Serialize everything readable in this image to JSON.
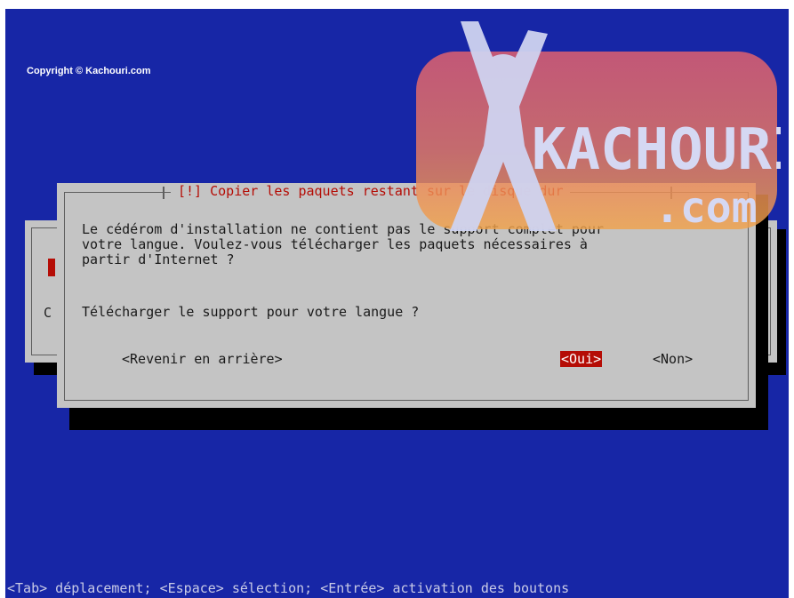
{
  "watermark": {
    "copyright": "Copyright © Kachouri.com",
    "logo_text": "KACHOURI",
    "logo_domain": ".com"
  },
  "background_dialog": {
    "visible_letter": "C"
  },
  "dialog": {
    "title": "[!] Copier les paquets restant sur le disque dur",
    "body_lines": [
      "Le cédérom d'installation ne contient pas le support complet pour",
      "votre langue. Voulez-vous télécharger les paquets nécessaires à",
      "partir d'Internet ?"
    ],
    "question": "Télécharger le support pour votre langue ?",
    "buttons": {
      "back": "<Revenir en arrière>",
      "yes": "<Oui>",
      "no": "<Non>"
    },
    "selected_button": "yes"
  },
  "footer": {
    "help": "<Tab> déplacement; <Espace> sélection; <Entrée> activation des boutons"
  },
  "colors": {
    "background": "#1726a6",
    "dialog": "#c4c4c4",
    "accent": "#b50d06",
    "logo_pink": "#e8626d",
    "logo_orange": "#f0a24a"
  }
}
